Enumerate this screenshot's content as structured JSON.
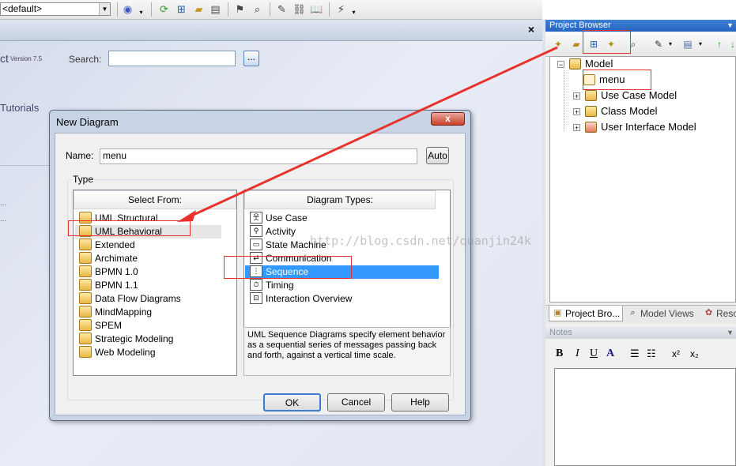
{
  "toolbar": {
    "perspective_value": "<default>",
    "icons": [
      "perspective-icon",
      "refresh-icon",
      "diagram-tree-icon",
      "open-folder-icon",
      "package-icon",
      "bookmark-icon",
      "find-icon",
      "edit-icon",
      "link-icon",
      "book-icon",
      "filter-icon"
    ]
  },
  "start_page": {
    "title_fragment": "ct",
    "version": "Version 7.5",
    "search_label": "Search:",
    "search_value": "",
    "search_button": "...",
    "tutorials_fragment": "Tutorials",
    "close_label": "×"
  },
  "dialog": {
    "title": "New Diagram",
    "close_label": "x",
    "name_label": "Name:",
    "name_value": "menu",
    "auto_button": "Auto",
    "type_group_label": "Type",
    "select_from_header": "Select From:",
    "select_from": [
      "UML Structural",
      "UML Behavioral",
      "Extended",
      "Archimate",
      "BPMN 1.0",
      "BPMN 1.1",
      "Data Flow Diagrams",
      "MindMapping",
      "SPEM",
      "Strategic Modeling",
      "Web Modeling"
    ],
    "selected_from_index": 1,
    "diagram_types_header": "Diagram Types:",
    "diagram_types": [
      {
        "label": "Use Case",
        "icon": "use-case-icon"
      },
      {
        "label": "Activity",
        "icon": "activity-icon"
      },
      {
        "label": "State Machine",
        "icon": "state-machine-icon"
      },
      {
        "label": "Communication",
        "icon": "communication-icon"
      },
      {
        "label": "Sequence",
        "icon": "sequence-icon"
      },
      {
        "label": "Timing",
        "icon": "timing-icon"
      },
      {
        "label": "Interaction Overview",
        "icon": "interaction-overview-icon"
      }
    ],
    "selected_type_index": 4,
    "description": "UML Sequence Diagrams specify element behavior as a sequential series of messages passing back and forth, against a vertical time scale.",
    "ok_button": "OK",
    "cancel_button": "Cancel",
    "help_button": "Help"
  },
  "watermark": "http://blog.csdn.net/quanjin24k",
  "project_browser": {
    "title": "Project Browser",
    "tree": {
      "root": "Model",
      "children": [
        "menu",
        "Use Case Model",
        "Class Model",
        "User Interface Model"
      ]
    },
    "tabs": [
      "Project Bro...",
      "Model Views",
      "Reso"
    ]
  },
  "notes": {
    "title": "Notes",
    "tools": [
      "B",
      "I",
      "U",
      "A"
    ]
  },
  "colors": {
    "selection": "#3399ff",
    "annotation_red": "#e8332c",
    "panel_title_blue": "#2f6fcf"
  }
}
